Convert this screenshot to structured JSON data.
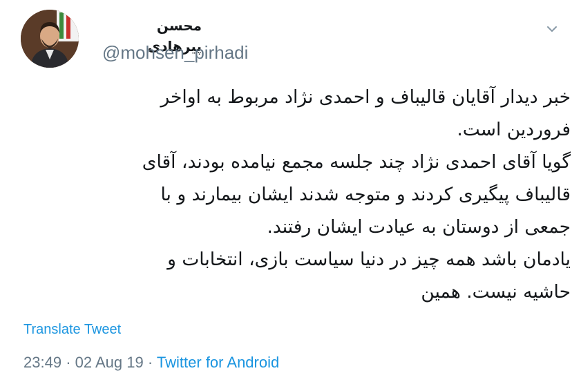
{
  "author": {
    "display_name": "محسن پیرهادی",
    "handle": "@mohsen_pirhadi"
  },
  "tweet": {
    "lines": [
      "خبر دیدار آقایان قالیباف و احمدی نژاد مربوط به اواخر",
      "فروردین است.",
      "گویا آقای احمدی نژاد چند جلسه مجمع نیامده بودند، آقای",
      "قالیباف پیگیری کردند و متوجه شدند ایشان بیمارند و با",
      "جمعی از دوستان به عیادت ایشان رفتند.",
      "یادمان باشد همه چیز در دنیا  سیاست بازی، انتخابات و",
      "حاشیه نیست. همین"
    ],
    "translate_label": "Translate Tweet",
    "time": "23:49",
    "separator": "·",
    "date": "02 Aug 19",
    "source": "Twitter for Android"
  },
  "icons": {
    "menu": "chevron-down-icon"
  },
  "colors": {
    "link": "#1b95e0",
    "meta_text": "#657786",
    "main_text": "#14171a",
    "background": "#ffffff"
  }
}
